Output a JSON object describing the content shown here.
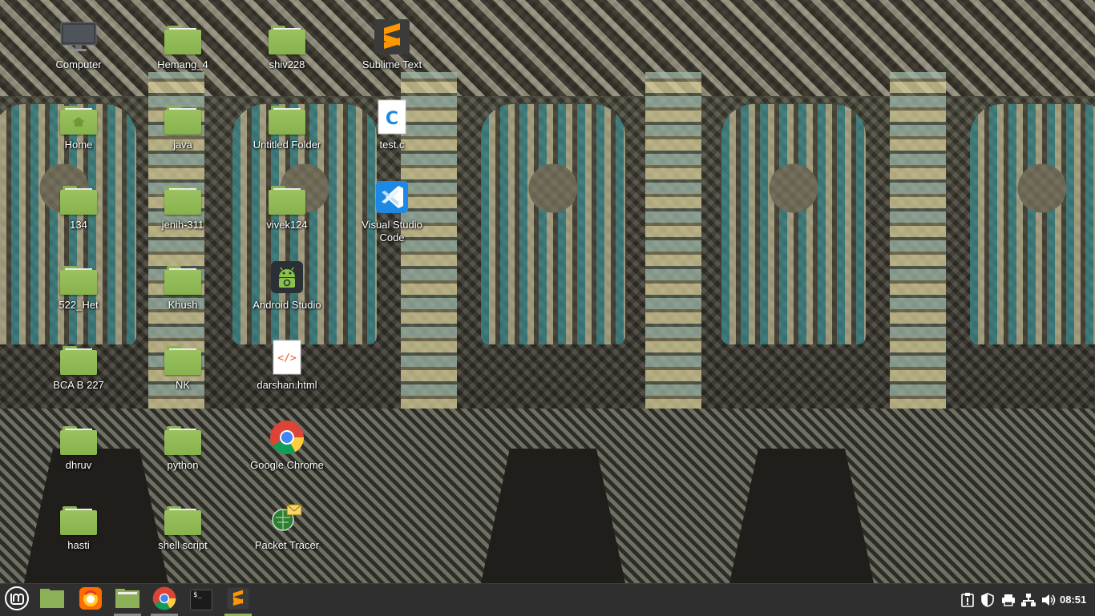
{
  "desktop": {
    "icons": [
      {
        "label": "Computer",
        "icon": "computer-icon"
      },
      {
        "label": "Hemang_4",
        "icon": "folder-icon"
      },
      {
        "label": "shiv228",
        "icon": "folder-icon"
      },
      {
        "label": "Sublime Text",
        "icon": "sublime-text-icon"
      },
      {
        "label": "Home",
        "icon": "home-folder-icon"
      },
      {
        "label": "java",
        "icon": "folder-icon"
      },
      {
        "label": "Untitled Folder",
        "icon": "folder-icon"
      },
      {
        "label": "test.c",
        "icon": "c-file-icon"
      },
      {
        "label": "134",
        "icon": "folder-icon"
      },
      {
        "label": "jenih-311",
        "icon": "folder-icon"
      },
      {
        "label": "vivek124",
        "icon": "folder-icon"
      },
      {
        "label": "Visual Studio Code",
        "icon": "vscode-icon"
      },
      {
        "label": "522_Het",
        "icon": "folder-icon"
      },
      {
        "label": "Khush",
        "icon": "folder-icon"
      },
      {
        "label": "Android Studio",
        "icon": "android-studio-icon"
      },
      {
        "label": "BCA B 227",
        "icon": "folder-icon"
      },
      {
        "label": "NK",
        "icon": "folder-icon"
      },
      {
        "label": "darshan.html",
        "icon": "html-file-icon"
      },
      {
        "label": "dhruv",
        "icon": "folder-icon"
      },
      {
        "label": "python",
        "icon": "folder-icon"
      },
      {
        "label": "Google Chrome",
        "icon": "chrome-icon"
      },
      {
        "label": "hasti",
        "icon": "folder-icon"
      },
      {
        "label": "shell script",
        "icon": "folder-icon"
      },
      {
        "label": "Packet Tracer",
        "icon": "packet-tracer-icon"
      }
    ]
  },
  "panel": {
    "launchers": [
      {
        "icon": "mint-menu-icon"
      },
      {
        "icon": "show-desktop-icon"
      },
      {
        "icon": "firefox-icon"
      },
      {
        "icon": "files-icon"
      },
      {
        "icon": "chrome-icon"
      },
      {
        "icon": "terminal-icon"
      },
      {
        "icon": "sublime-text-icon"
      }
    ],
    "terminal_prompt": "$_",
    "tray": [
      "update-manager-icon",
      "shield-icon",
      "printer-icon",
      "network-icon",
      "volume-icon"
    ],
    "clock": "08:51"
  },
  "colors": {
    "folder": "#8cb056",
    "panel": "#2f2f2f",
    "accent": "#8fb353"
  }
}
